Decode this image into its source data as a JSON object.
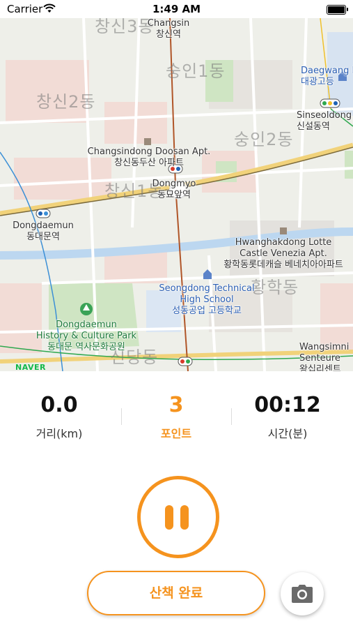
{
  "status_bar": {
    "carrier": "Carrier",
    "time": "1:49 AM"
  },
  "map": {
    "provider_logo": "NAVER",
    "districts": [
      "창신3동",
      "숭인1동",
      "창신2동",
      "숭인2동",
      "창신1동",
      "황학동",
      "신당동"
    ],
    "stations": {
      "changsin": {
        "en": "Changsin",
        "ko": "창신역"
      },
      "sinseoldong": {
        "en": "Sinseoldong",
        "ko": "신설동역"
      },
      "dongmyo": {
        "en": "Dongmyo",
        "ko": "동묘앞역"
      },
      "dongdaemun": {
        "en": "Dongdaemun",
        "ko": "동대문역"
      },
      "wangsimni": {
        "en": "Wangsimni",
        "sub": "Senteure",
        "ko": "왕십리센트"
      }
    },
    "places": {
      "doosan": {
        "en": "Changsindong Doosan Apt.",
        "ko": "창신동두산 아파트"
      },
      "hwanghak": {
        "en1": "Hwanghakdong Lotte",
        "en2": "Castle Venezia Apt.",
        "ko": "황학동롯데캐슬 베네치아아파트"
      },
      "seongdong": {
        "en1": "Seongdong Technical",
        "en2": "High School",
        "ko": "성동공업 고등학교"
      },
      "daegwang": {
        "en": "Daegwang H",
        "ko": "대광고등"
      },
      "ddp": {
        "en1": "Dongdaemun",
        "en2": "History & Culture Park",
        "ko": "동대문 역사문화공원"
      }
    }
  },
  "stats": {
    "distance": {
      "value": "0.0",
      "label": "거리(km)"
    },
    "points": {
      "value": "3",
      "label": "포인트"
    },
    "time": {
      "value": "00:12",
      "label": "시간(분)"
    }
  },
  "controls": {
    "finish_label": "산책 완료"
  },
  "colors": {
    "accent": "#f5931e"
  }
}
